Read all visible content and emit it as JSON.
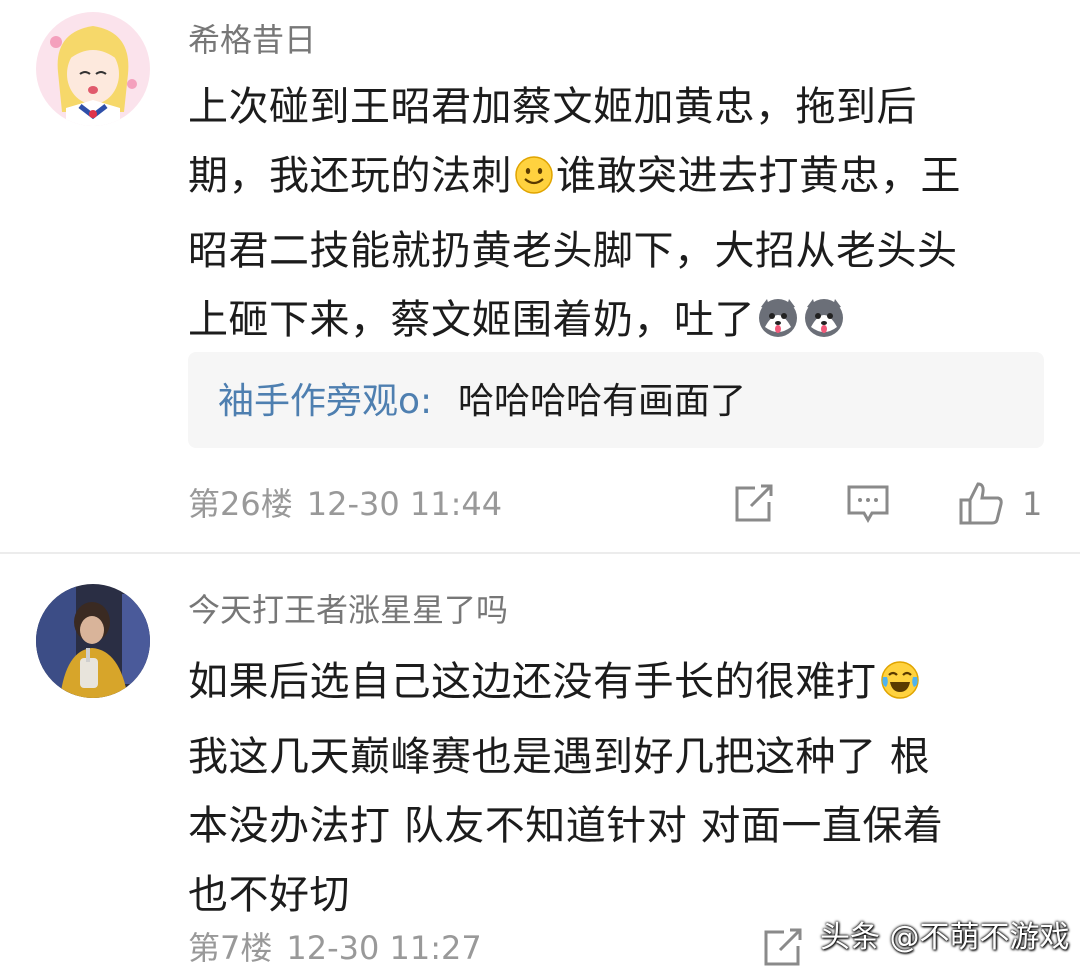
{
  "comments": [
    {
      "username": "希格昔日",
      "lines": [
        "上次碰到王昭君加蔡文姬加黄忠，拖到后",
        "期，我还玩的法刺",
        "谁敢突进去打黄忠，王",
        "昭君二技能就扔黄老头脚下，大招从老头头",
        "上砸下来，蔡文姬围着奶，吐了"
      ],
      "reply": {
        "user": "袖手作旁观o:",
        "text": "哈哈哈哈有画面了"
      },
      "floor": "第26楼",
      "time": "12-30 11:44",
      "likes": "1"
    },
    {
      "username": "今天打王者涨星星了吗",
      "lines": [
        "如果后选自己这边还没有手长的很难打",
        "我这几天巅峰赛也是遇到好几把这种了 根",
        "本没办法打 队友不知道针对 对面一直保着",
        "也不好切"
      ],
      "floor": "第7楼",
      "time": "12-30 11:27"
    }
  ],
  "watermark": "头条 @不萌不游戏",
  "icons": {
    "share": "share-icon",
    "reply": "comment-icon",
    "like": "thumbs-up-icon",
    "smile": "smile-emoji-icon",
    "husky": "husky-emoji-icon",
    "laugh": "tears-of-joy-emoji-icon"
  },
  "colors": {
    "username": "#777777",
    "reply_user": "#4e7fb0",
    "meta": "#999999",
    "reply_bg": "#f6f6f6"
  }
}
